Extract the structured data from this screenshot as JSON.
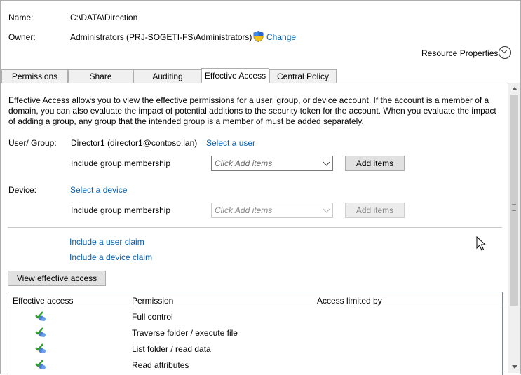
{
  "header": {
    "name_label": "Name:",
    "name_value": "C:\\DATA\\Direction",
    "owner_label": "Owner:",
    "owner_value": "Administrators (PRJ-SOGETI-FS\\Administrators)",
    "change_link": "Change",
    "resource_properties": "Resource Properties"
  },
  "tabs": [
    {
      "label": "Permissions",
      "active": false
    },
    {
      "label": "Share",
      "active": false
    },
    {
      "label": "Auditing",
      "active": false
    },
    {
      "label": "Effective Access",
      "active": true
    },
    {
      "label": "Central Policy",
      "active": false
    }
  ],
  "description": {
    "line1": "Effective Access allows you to view the effective permissions for a user, group, or device account. If the account is a member of a",
    "line2": "domain, you can also evaluate the impact of potential additions to the security token for the account. When you evaluate the impact",
    "line3": "of adding a group, any group that the intended group is a member of must be added separately."
  },
  "user_group": {
    "label": "User/ Group:",
    "value": "Director1 (director1@contoso.lan)",
    "select_link": "Select a user",
    "include_label": "Include group membership",
    "dropdown_placeholder": "Click Add items",
    "add_button": "Add items"
  },
  "device": {
    "label": "Device:",
    "select_link": "Select a device",
    "include_label": "Include group membership",
    "dropdown_placeholder": "Click Add items",
    "add_button": "Add items"
  },
  "claims": {
    "user_claim": "Include a user claim",
    "device_claim": "Include a device claim"
  },
  "view_button": "View effective access",
  "table": {
    "headers": {
      "effective_access": "Effective access",
      "permission": "Permission",
      "access_limited_by": "Access limited by"
    },
    "rows": [
      {
        "permission": "Full control"
      },
      {
        "permission": "Traverse folder / execute file"
      },
      {
        "permission": "List folder / read data"
      },
      {
        "permission": "Read attributes"
      }
    ]
  },
  "colors": {
    "link": "#0a5fa8",
    "check_green": "#2e9e2e"
  },
  "icons": {
    "owner_change": "uac-shield-icon",
    "expand": "chevron-down-circle-icon",
    "row_check": "effective-access-check-icon"
  }
}
